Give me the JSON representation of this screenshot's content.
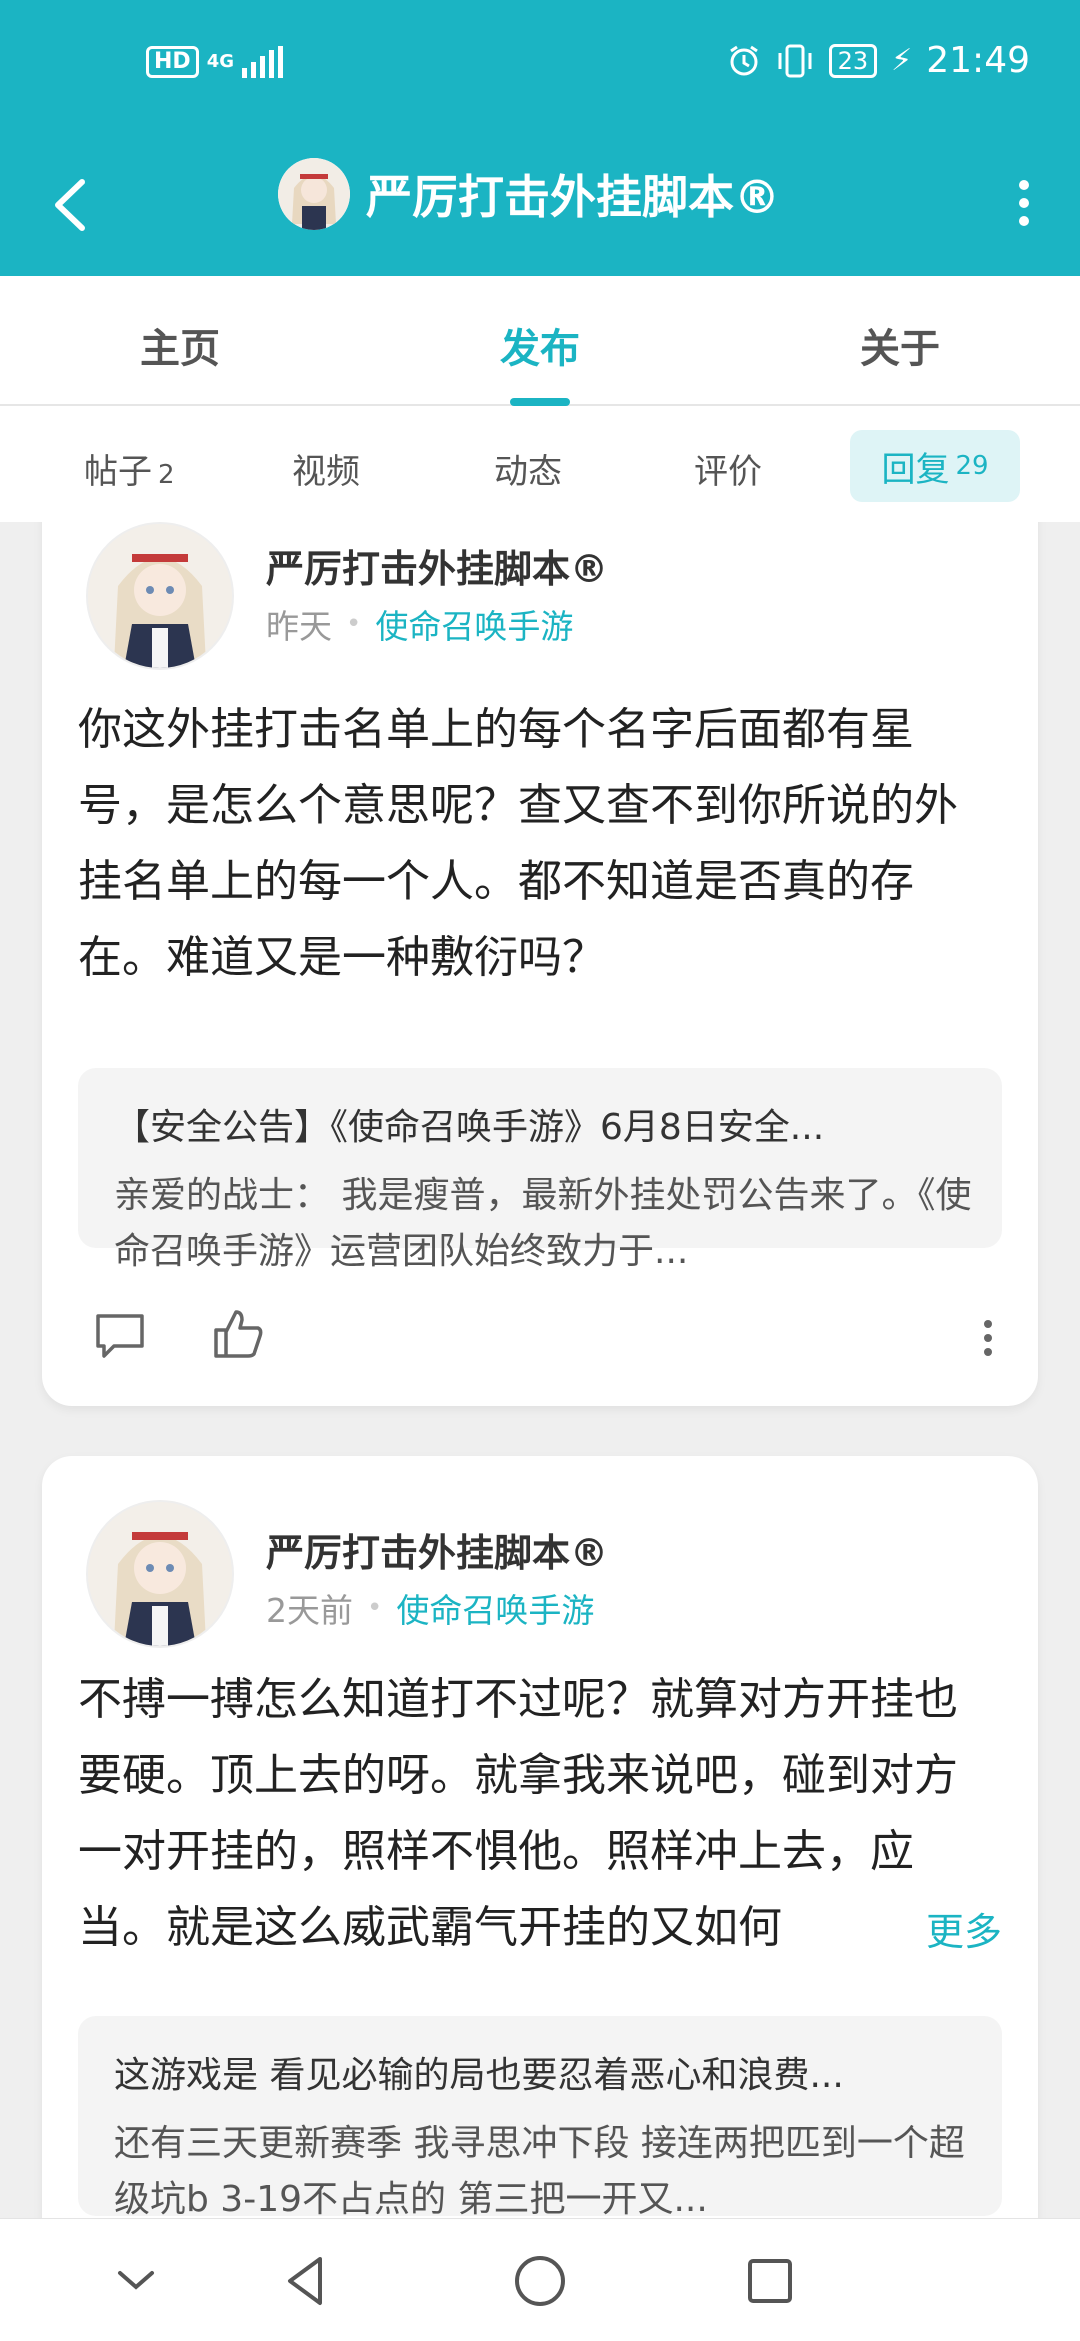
{
  "status_bar": {
    "network_left": "HD",
    "network_type": "4G",
    "battery": "23",
    "time": "21:49"
  },
  "header": {
    "title": "严厉打击外挂脚本®"
  },
  "main_tabs": [
    {
      "label": "主页",
      "active": false
    },
    {
      "label": "发布",
      "active": true
    },
    {
      "label": "关于",
      "active": false
    }
  ],
  "sub_tabs": [
    {
      "label": "帖子",
      "count": "2"
    },
    {
      "label": "视频",
      "count": ""
    },
    {
      "label": "动态",
      "count": ""
    },
    {
      "label": "评价",
      "count": ""
    },
    {
      "label": "回复",
      "count": "29",
      "active": true
    }
  ],
  "posts": [
    {
      "author": "严厉打击外挂脚本®",
      "time": "昨天",
      "game": "使命召唤手游",
      "body": "你这外挂打击名单上的每个名字后面都有星号，是怎么个意思呢？查又查不到你所说的外挂名单上的每一个人。都不知道是否真的存在。难道又是一种敷衍吗？",
      "quote_title": "【安全公告】《使命召唤手游》6月8日安全...",
      "quote_body": "亲爱的战士： 我是瘦普，最新外挂处罚公告来了。《使命召唤手游》运营团队始终致力于..."
    },
    {
      "author": "严厉打击外挂脚本®",
      "time": "2天前",
      "game": "使命召唤手游",
      "body": "不搏一搏怎么知道打不过呢？就算对方开挂也要硬。顶上去的呀。就拿我来说吧，碰到对方一对开挂的，照样不惧他。照样冲上去，应当。就是这么威武霸气开挂的又如何",
      "more": "更多",
      "quote_title": "这游戏是 看见必输的局也要忍着恶心和浪费...",
      "quote_body": "还有三天更新赛季 我寻思冲下段 接连两把匹到一个超级坑b 3-19不占点的 第三把一开又..."
    }
  ],
  "colors": {
    "accent": "#1bb4c3",
    "background": "#efefef"
  }
}
